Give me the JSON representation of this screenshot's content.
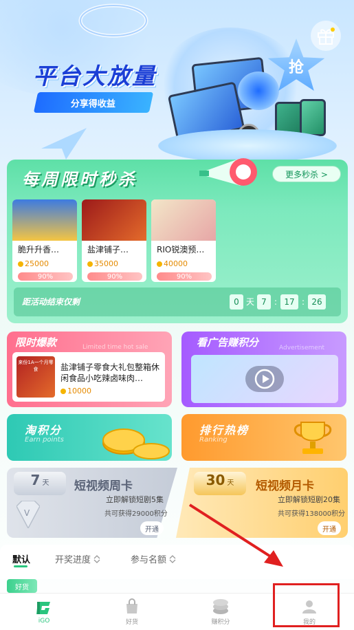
{
  "hero": {
    "title": "平台大放量",
    "share_label": "分享得收益",
    "star_label": "抢"
  },
  "flash_sale": {
    "title": "每周限时秒杀",
    "more_label": "更多秒杀 >",
    "products": [
      {
        "name": "脆升升香…",
        "price": "25000",
        "progress": "90%"
      },
      {
        "name": "盐津铺子…",
        "price": "35000",
        "progress": "90%"
      },
      {
        "name": "RIO锐澳预…",
        "price": "40000",
        "progress": "90%"
      }
    ],
    "countdown": {
      "label": "距活动结束仅剩",
      "days": "0",
      "day_unit": "天",
      "hours": "7",
      "sep1": ":",
      "minutes": "17",
      "sep2": ":",
      "seconds": "26"
    }
  },
  "hot_sale": {
    "title": "限时爆款",
    "subtitle": "Limited time hot sale",
    "product_name": "盐津铺子零食大礼包整箱休闲食品小吃辣卤味肉…",
    "price": "10000",
    "img_caption": "来份1A一个月零食"
  },
  "ad": {
    "title": "看广告赚积分",
    "subtitle": "Advertisement"
  },
  "tao": {
    "title": "淘积分",
    "subtitle": "Earn points"
  },
  "rank": {
    "title": "排行热榜",
    "subtitle": "Ranking"
  },
  "week_card": {
    "days": "7",
    "unit": "天",
    "title": "短视频周卡",
    "line1": "立即解锁短剧5集",
    "line2": "共可获得29000积分",
    "button": "开通",
    "color": "#5b6478"
  },
  "month_card": {
    "days": "30",
    "unit": "天",
    "title": "短视频月卡",
    "line1": "立即解锁短剧20集",
    "line2": "共可获得138000积分",
    "button": "开通",
    "color": "#b35a00"
  },
  "tabs": [
    {
      "label": "默认",
      "active": true
    },
    {
      "label": "开奖进度",
      "icon": "sort-icon"
    },
    {
      "label": "参与名额",
      "icon": "sort-icon"
    }
  ],
  "goods_badge": "好货",
  "nav": [
    {
      "label": "iGO",
      "icon": "igo-logo-icon"
    },
    {
      "label": "好货",
      "icon": "bag-icon"
    },
    {
      "label": "赚积分",
      "icon": "coin-stack-icon"
    },
    {
      "label": "我的",
      "icon": "user-icon"
    }
  ],
  "colors": {
    "accent_green": "#2ac57e",
    "annotation_red": "#e02020"
  }
}
